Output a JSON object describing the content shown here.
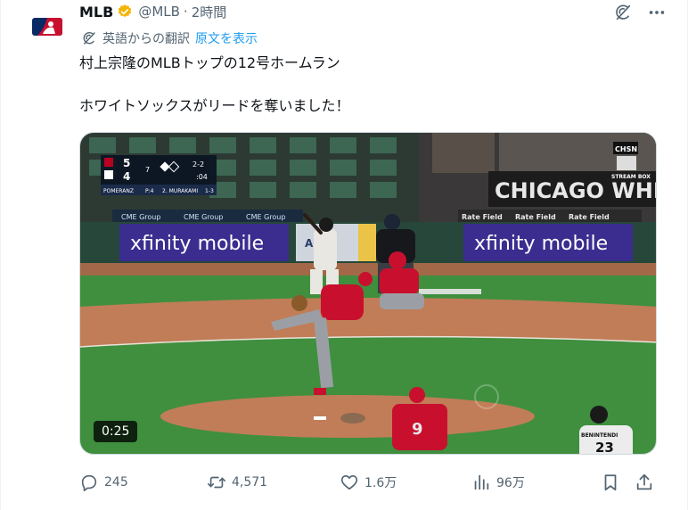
{
  "author": {
    "name": "MLB",
    "handle": "@MLB",
    "separator": "·",
    "time": "2時間"
  },
  "translation": {
    "label": "英語からの翻訳",
    "show_original": "原文を表示"
  },
  "post": {
    "line1": "村上宗隆のMLBトップの12号ホームラン",
    "line2": "ホワイトソックスがリードを奪いました！"
  },
  "video": {
    "duration": "0:25",
    "scorebug": {
      "away_score": "5",
      "home_score": "4",
      "inning": "7",
      "count": "2-2",
      "clock": ":04",
      "pitcher": "POMERANZ",
      "pitcher_stat": "P:4",
      "batter": "2. MURAKAMI",
      "batter_stat": "1-3"
    },
    "ads": {
      "cme1": "CME Group",
      "cme2": "CME Group",
      "cme3": "CME Group",
      "xfinity_left": "xfinity mobile",
      "xfinity_right": "xfinity mobile",
      "rate1": "Rate Field",
      "rate2": "Rate Field",
      "rate3": "Rate Field",
      "chicago": "CHICAGO WHITE",
      "chsn": "CHSN",
      "stream": "STREAM BOX",
      "aga": "AGA"
    },
    "jersey": {
      "pitcher_num": "9",
      "batter_name": "BENINTENDI",
      "batter_num": "23"
    }
  },
  "metrics": {
    "replies": "245",
    "reposts": "4,571",
    "likes": "1.6万",
    "views": "96万"
  },
  "colors": {
    "link": "#1d9bf0",
    "muted": "#536471",
    "verified": "#f4b400",
    "field_green": "#3f8f3f",
    "dirt": "#c17d57",
    "xfinity": "#3b2d8f"
  }
}
